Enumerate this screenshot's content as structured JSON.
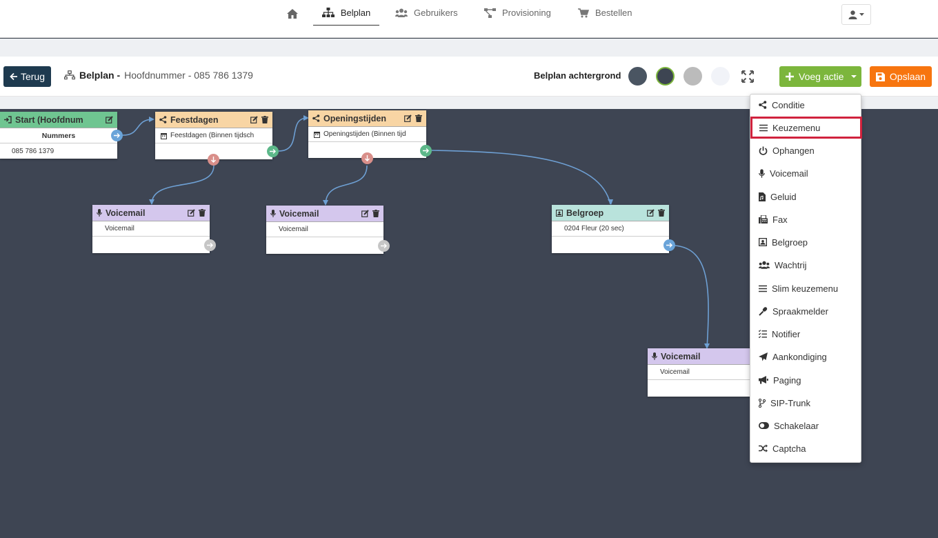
{
  "nav": {
    "items": [
      {
        "label": "Belplan",
        "active": true
      },
      {
        "label": "Gebruikers",
        "active": false
      },
      {
        "label": "Provisioning",
        "active": false
      },
      {
        "label": "Bestellen",
        "active": false
      }
    ]
  },
  "toolbar": {
    "back_label": "Terug",
    "crumb_title": "Belplan -",
    "crumb_sub": "Hoofdnummer - 085 786 1379",
    "bg_label": "Belplan achtergrond",
    "swatches": [
      "#4a5562",
      "#3d4552",
      "#bbbbbb",
      "#f1f3f8"
    ],
    "add_label": "Voeg actie",
    "save_label": "Opslaan"
  },
  "nodes": {
    "start": {
      "title": "Start (Hoofdnum",
      "header": "Nummers",
      "number": "085 786 1379"
    },
    "feestdagen": {
      "title": "Feestdagen",
      "row": "Feestdagen (Binnen tijdsch"
    },
    "openingstijden": {
      "title": "Openingstijden",
      "row": "Openingstijden (Binnen tijd"
    },
    "voicemail1": {
      "title": "Voicemail",
      "row": "Voicemail"
    },
    "voicemail2": {
      "title": "Voicemail",
      "row": "Voicemail"
    },
    "belgroep": {
      "title": "Belgroep",
      "row": "0204 Fleur (20 sec)"
    },
    "voicemail3": {
      "title": "Voicemail",
      "row": "Voicemail"
    }
  },
  "menu": {
    "items": [
      {
        "label": "Conditie",
        "icon": "share-icon"
      },
      {
        "label": "Keuzemenu",
        "icon": "bars-icon",
        "highlighted": true
      },
      {
        "label": "Ophangen",
        "icon": "power-icon"
      },
      {
        "label": "Voicemail",
        "icon": "microphone-icon"
      },
      {
        "label": "Geluid",
        "icon": "audio-file-icon"
      },
      {
        "label": "Fax",
        "icon": "fax-icon"
      },
      {
        "label": "Belgroep",
        "icon": "group-square-icon"
      },
      {
        "label": "Wachtrij",
        "icon": "users-icon"
      },
      {
        "label": "Slim keuzemenu",
        "icon": "bars-icon"
      },
      {
        "label": "Spraakmelder",
        "icon": "microphone-alt-icon"
      },
      {
        "label": "Notifier",
        "icon": "tasks-icon"
      },
      {
        "label": "Aankondiging",
        "icon": "paper-plane-icon"
      },
      {
        "label": "Paging",
        "icon": "bullhorn-icon"
      },
      {
        "label": "SIP-Trunk",
        "icon": "code-branch-icon"
      },
      {
        "label": "Schakelaar",
        "icon": "toggle-icon"
      },
      {
        "label": "Captcha",
        "icon": "shuffle-icon"
      }
    ]
  }
}
